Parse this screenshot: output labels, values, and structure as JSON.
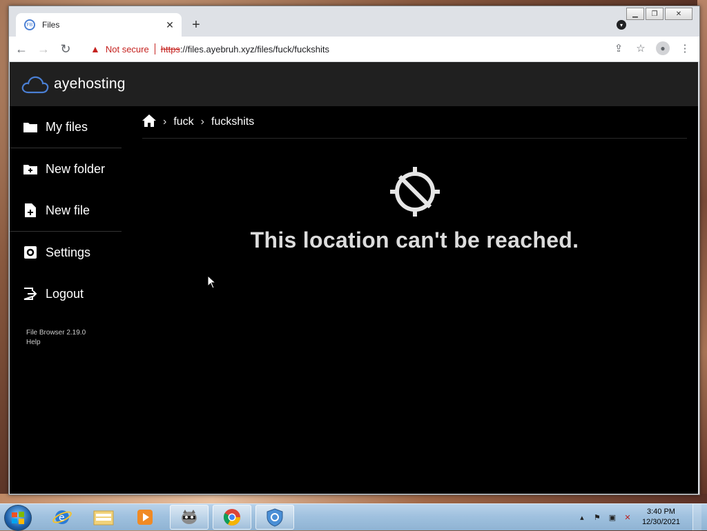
{
  "browser": {
    "tab_title": "Files",
    "favicon_label": "FB",
    "not_secure_label": "Not secure",
    "url_scheme": "https",
    "url_rest": "://files.ayebruh.xyz/files/fuck/fuckshits"
  },
  "app": {
    "brand": "ayehosting",
    "sidebar": {
      "my_files": "My files",
      "new_folder": "New folder",
      "new_file": "New file",
      "settings": "Settings",
      "logout": "Logout",
      "version": "File Browser 2.19.0",
      "help": "Help"
    },
    "breadcrumbs": [
      "fuck",
      "fuckshits"
    ],
    "error_message": "This location can't be reached."
  },
  "taskbar": {
    "time": "3:40 PM",
    "date": "12/30/2021"
  },
  "colors": {
    "accent_blue": "#4a7fd4",
    "warning_red": "#c5221f",
    "app_bg": "#000000",
    "header_bg": "#202020"
  }
}
